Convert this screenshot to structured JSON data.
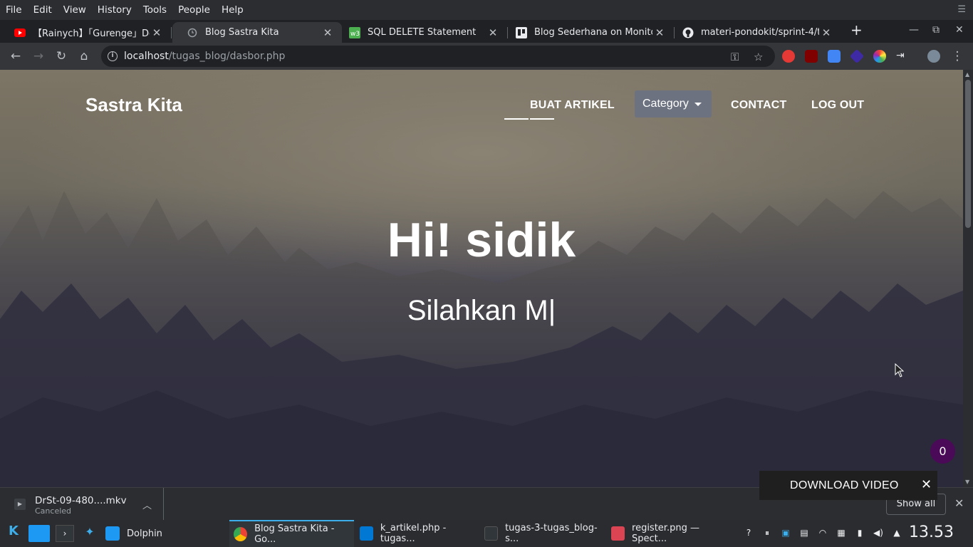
{
  "menubar": {
    "items": [
      "File",
      "Edit",
      "View",
      "History",
      "Tools",
      "People",
      "Help"
    ]
  },
  "tabs": [
    {
      "title": "【Rainych】「Gurenge」Demon S",
      "icon": "youtube-icon",
      "active": false
    },
    {
      "title": "Blog Sastra Kita",
      "icon": "page-loading-icon",
      "active": true
    },
    {
      "title": "SQL DELETE Statement",
      "icon": "w3schools-icon",
      "active": false
    },
    {
      "title": "Blog Sederhana on Monitor",
      "icon": "trello-icon",
      "active": false
    },
    {
      "title": "materi-pondokit/sprint-4/tugas",
      "icon": "github-icon",
      "active": false
    }
  ],
  "address": {
    "host": "localhost",
    "path": "/tugas_blog/dasbor.php"
  },
  "site": {
    "brand": "Sastra Kita",
    "nav": {
      "buat_artikel": "BUAT ARTIKEL",
      "category": "Category",
      "contact": "CONTACT",
      "logout": "LOG OUT"
    },
    "hero_title": "Hi! sidik",
    "hero_subtitle": "Silahkan M|",
    "badge_count": "0"
  },
  "download_video": {
    "label": "DOWNLOAD VIDEO"
  },
  "downloads": {
    "filename": "DrSt-09-480....mkv",
    "status": "Canceled",
    "show_all": "Show all"
  },
  "taskbar": {
    "tasks": [
      {
        "label": "Dolphin"
      },
      {
        "label": "Blog Sastra Kita - Go..."
      },
      {
        "label": "k_artikel.php - tugas..."
      },
      {
        "label": "tugas-3-tugas_blog-s..."
      },
      {
        "label": "register.png — Spect..."
      }
    ],
    "clock": "13.53"
  },
  "colors": {
    "category_bg": "#6c7280",
    "badge_bg": "#4a0a57",
    "taskbar_accent": "#3daee9"
  }
}
